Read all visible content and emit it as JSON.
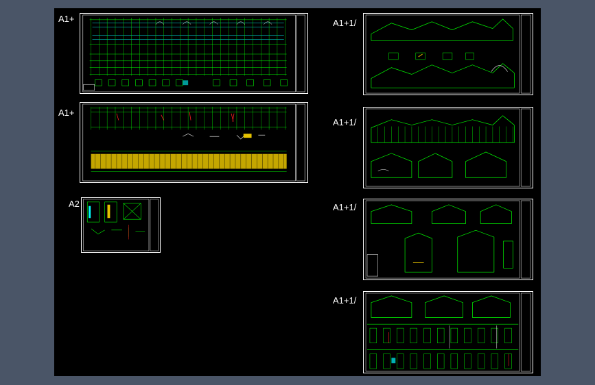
{
  "app": {
    "background_color": "#4a5567",
    "canvas_color": "#000000",
    "frame_color": "#ffffff",
    "line_colors": {
      "structure": "#00ff00",
      "axis": "#00ffff",
      "highlight": "#ff2020",
      "fill": "#e6c300",
      "annotation": "#ffffff"
    }
  },
  "sheets": [
    {
      "id": "sheet-1",
      "label": "A1+"
    },
    {
      "id": "sheet-2",
      "label": "A1+"
    },
    {
      "id": "sheet-3",
      "label": "A2"
    },
    {
      "id": "sheet-4",
      "label": "A1+1/"
    },
    {
      "id": "sheet-5",
      "label": "A1+1/"
    },
    {
      "id": "sheet-6",
      "label": "A1+1/"
    },
    {
      "id": "sheet-7",
      "label": "A1+1/"
    }
  ]
}
